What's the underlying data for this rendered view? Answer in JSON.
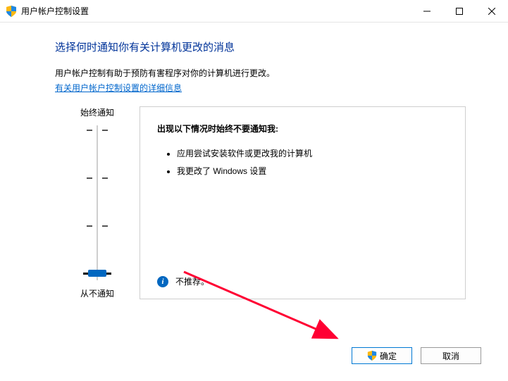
{
  "titlebar": {
    "title": "用户帐户控制设置"
  },
  "content": {
    "heading": "选择何时通知你有关计算机更改的消息",
    "description": "用户帐户控制有助于预防有害程序对你的计算机进行更改。",
    "link_text": "有关用户帐户控制设置的详细信息"
  },
  "slider": {
    "top_label": "始终通知",
    "bottom_label": "从不通知"
  },
  "info_panel": {
    "heading": "出现以下情况时始终不要通知我:",
    "bullets": [
      "应用尝试安装软件或更改我的计算机",
      "我更改了 Windows 设置"
    ],
    "recommend_text": "不推荐。"
  },
  "buttons": {
    "ok": "确定",
    "cancel": "取消"
  }
}
